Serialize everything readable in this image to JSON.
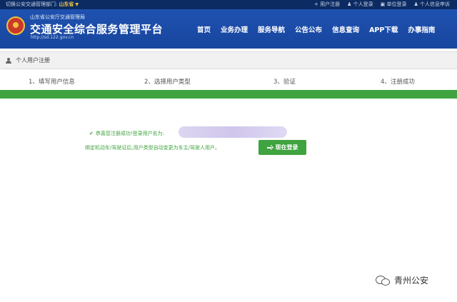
{
  "topbar": {
    "switch_label": "切换公安交通管理部门:",
    "province": "山东省",
    "links": [
      "用户注册",
      "个人登录",
      "单位登录",
      "个人信息申诉"
    ]
  },
  "header": {
    "subtitle": "山东省公安厅交通管理局",
    "title": "交通安全综合服务管理平台",
    "url": "http://sd.122.gov.cn",
    "nav": [
      "首页",
      "业务办理",
      "服务导航",
      "公告公布",
      "信息查询",
      "APP下载",
      "办事指南"
    ]
  },
  "panel": {
    "title": "个人用户注册"
  },
  "steps": [
    "1、填写用户信息",
    "2、选择用户类型",
    "3、验证",
    "4、注册成功"
  ],
  "progress_fraction": 1.0,
  "messages": {
    "success": "恭喜您注册成功!登录用户名为:",
    "note": "绑定机动车/驾驶证后,用户类型自动变更为车主/驾驶人用户。"
  },
  "login_button": "现在登录",
  "watermark": "青州公安",
  "colors": {
    "header_blue": "#1f52b0",
    "topbar_navy": "#0c2b62",
    "success_green": "#3fa33f"
  }
}
